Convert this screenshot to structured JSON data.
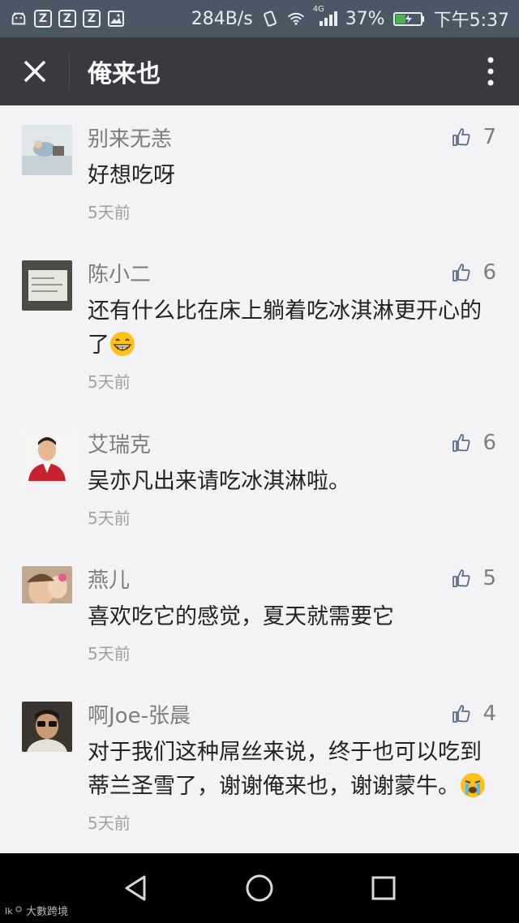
{
  "status_bar": {
    "speed": "284B/s",
    "network": "4G",
    "battery": "37%",
    "time": "下午5:37",
    "icons": [
      "android-icon",
      "z-app-icon",
      "z-app-icon",
      "z-app-icon",
      "gallery-icon",
      "vibrate-icon",
      "wifi-icon",
      "signal-icon",
      "battery-icon"
    ]
  },
  "header": {
    "title": "俺来也",
    "close_icon": "close-icon",
    "more_icon": "more-vertical-icon",
    "bg_color": "#393a3f"
  },
  "comments": [
    {
      "name": "别来无恙",
      "text": "好想吃呀",
      "emoji": "",
      "time": "5天前",
      "likes": "7"
    },
    {
      "name": "陈小二",
      "text": "还有什么比在床上躺着吃冰淇淋更开心的了",
      "emoji": "grin-emoji",
      "time": "5天前",
      "likes": "6"
    },
    {
      "name": "艾瑞克",
      "text": "吴亦凡出来请吃冰淇淋啦。",
      "emoji": "",
      "time": "5天前",
      "likes": "6"
    },
    {
      "name": "燕儿",
      "text": "喜欢吃它的感觉，夏天就需要它",
      "emoji": "",
      "time": "5天前",
      "likes": "5"
    },
    {
      "name": "啊Joe-张晨",
      "text": "对于我们这种屌丝来说，终于也可以吃到蒂兰圣雪了，谢谢俺来也，谢谢蒙牛。",
      "emoji": "crying-emoji",
      "time": "5天前",
      "likes": "4"
    }
  ],
  "nav_bar": {
    "back_icon": "back-triangle-icon",
    "home_icon": "home-circle-icon",
    "recents_icon": "recents-square-icon"
  },
  "watermark": "大數跨境"
}
